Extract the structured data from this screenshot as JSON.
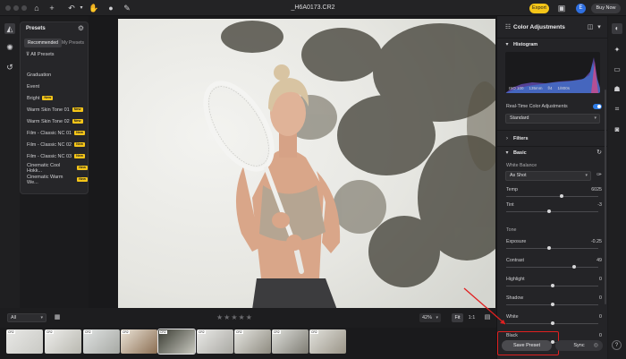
{
  "document": {
    "title": "_H6A0173.CR2"
  },
  "topbar": {
    "export_label": "Export",
    "avatar_letter": "E",
    "buy_label": "Buy Now"
  },
  "presets_panel": {
    "title": "Presets",
    "tabs": [
      "Recommended",
      "My Presets"
    ],
    "all_presets_label": "All Presets",
    "items": [
      {
        "label": "Graduation",
        "new": false
      },
      {
        "label": "Event",
        "new": false
      },
      {
        "label": "Bright",
        "new": true
      },
      {
        "label": "Warm Skin Tone 01",
        "new": true
      },
      {
        "label": "Warm Skin Tone 02",
        "new": true
      },
      {
        "label": "Film - Classic NC 01",
        "new": true
      },
      {
        "label": "Film - Classic NC 02",
        "new": true
      },
      {
        "label": "Film - Classic NC 03",
        "new": true
      },
      {
        "label": "Cinematic Cool Hokk...",
        "new": true
      },
      {
        "label": "Cinematic Warm We...",
        "new": true
      }
    ],
    "new_badge": "New"
  },
  "bottom": {
    "filter_value": "All",
    "zoom_value": "42%",
    "fit_label": "Fit",
    "one_to_one_label": "1:1",
    "rating_stars": "★★★★★"
  },
  "filmstrip": {
    "thumbs": [
      {
        "label": "CR2"
      },
      {
        "label": "CR2"
      },
      {
        "label": "CR2"
      },
      {
        "label": "CR2"
      },
      {
        "label": "CR2"
      },
      {
        "label": "CR2"
      },
      {
        "label": "CR2"
      },
      {
        "label": "CR2"
      },
      {
        "label": "CR2"
      }
    ]
  },
  "right_panel": {
    "title": "Color Adjustments",
    "histogram": {
      "label": "Histogram",
      "iso": "ISO 100",
      "focal": "135mm",
      "aperture": "f/4",
      "shutter": "1/800s"
    },
    "realtime_label": "Real-Time Color Adjustments",
    "realtime_mode": "Standard",
    "filters_label": "Filters",
    "basic_label": "Basic",
    "white_balance": {
      "label": "White Balance",
      "value": "As Shot"
    },
    "sliders_wb": [
      {
        "label": "Temp",
        "value": "6025",
        "pos": 0.6
      },
      {
        "label": "Tint",
        "value": "-3",
        "pos": 0.47
      }
    ],
    "tone_label": "Tone",
    "sliders_tone": [
      {
        "label": "Exposure",
        "value": "-0.25",
        "pos": 0.47
      },
      {
        "label": "Contrast",
        "value": "49",
        "pos": 0.74
      },
      {
        "label": "Highlight",
        "value": "0",
        "pos": 0.5
      },
      {
        "label": "Shadow",
        "value": "0",
        "pos": 0.5
      },
      {
        "label": "White",
        "value": "0",
        "pos": 0.5
      },
      {
        "label": "Black",
        "value": "0",
        "pos": 0.5
      }
    ],
    "save_preset_label": "Save Preset",
    "sync_label": "Sync"
  },
  "colors": {
    "accent": "#f5c518",
    "toggle": "#2f7de8",
    "highlight_box": "#e02020"
  }
}
